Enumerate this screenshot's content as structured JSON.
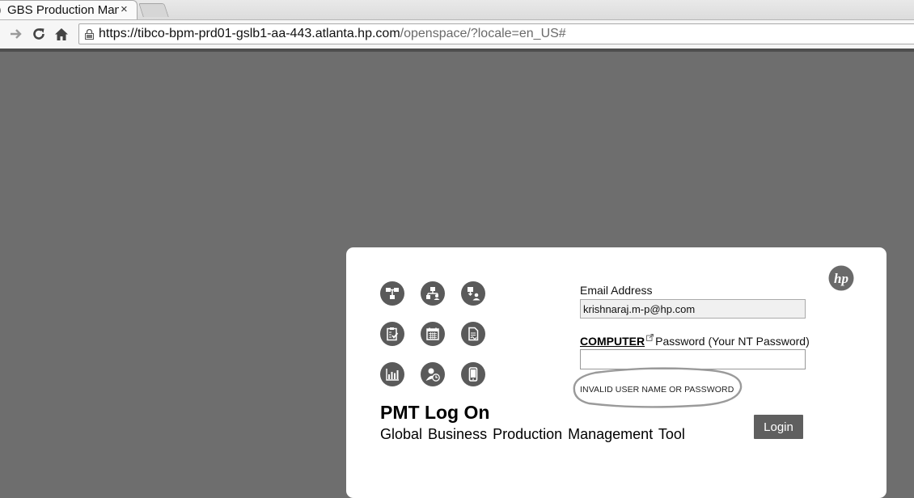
{
  "browser": {
    "tab_title": "GBS Production Man",
    "tab_close": "×",
    "url_host": "https://tibco-bpm-prd01-gslb1-aa-443.atlanta.hp.com",
    "url_path": "/openspace/?locale=en_US#"
  },
  "login": {
    "title": "PMT Log On",
    "subtitle": "Global  Business Production Management Tool",
    "email_label": "Email Address",
    "email_value": "krishnaraj.m-p@hp.com",
    "computer_link": "COMPUTER",
    "password_label": "Password (Your NT Password)",
    "password_value": "",
    "error_message": "INVALID USER NAME OR PASSWORD",
    "login_button": "Login",
    "logo_text": "hp"
  },
  "icons": [
    "org-chart-icon",
    "hierarchy-users-icon",
    "download-user-icon",
    "clipboard-check-icon",
    "calendar-icon",
    "document-sign-icon",
    "bar-chart-icon",
    "user-clock-icon",
    "mobile-phone-icon"
  ],
  "colors": {
    "page_background": "#6e6e6e",
    "panel_background": "#ffffff",
    "button_background": "#5f5f5f",
    "icon_background": "#5a5a5a"
  }
}
